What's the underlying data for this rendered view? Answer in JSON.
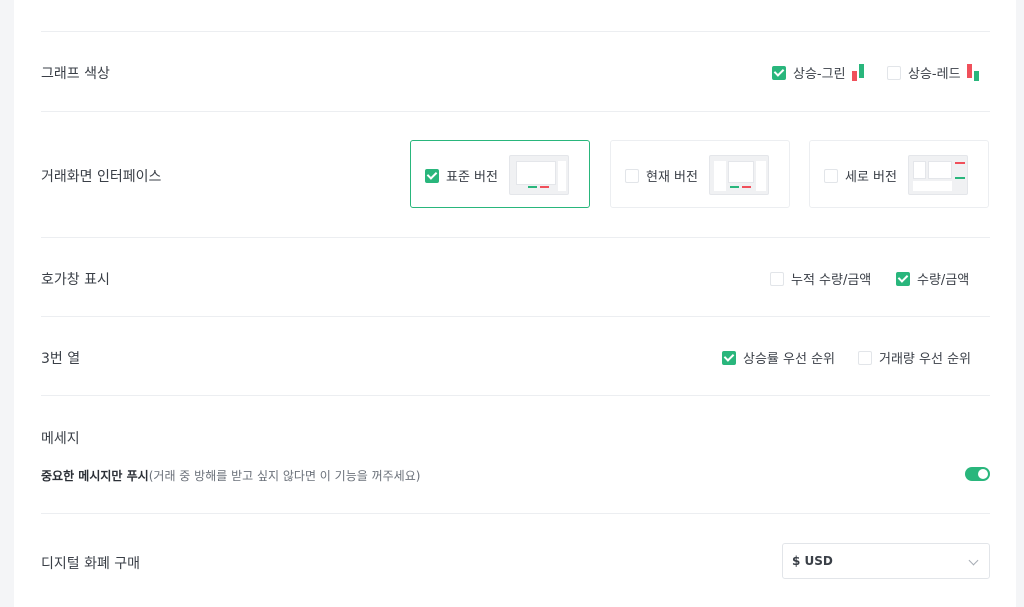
{
  "graph_color": {
    "label": "그래프 색상",
    "options": [
      {
        "label": "상승-그린",
        "checked": true
      },
      {
        "label": "상승-레드",
        "checked": false
      }
    ]
  },
  "trade_interface": {
    "label": "거래화면 인터페이스",
    "options": [
      {
        "label": "표준 버전",
        "checked": true
      },
      {
        "label": "현재 버전",
        "checked": false
      },
      {
        "label": "세로 버전",
        "checked": false
      }
    ]
  },
  "orderbook": {
    "label": "호가창 표시",
    "options": [
      {
        "label": "누적 수량/금액",
        "checked": false
      },
      {
        "label": "수량/금액",
        "checked": true
      }
    ]
  },
  "third_column": {
    "label": "3번 열",
    "options": [
      {
        "label": "상승률 우선 순위",
        "checked": true
      },
      {
        "label": "거래량 우선 순위",
        "checked": false
      }
    ]
  },
  "message": {
    "label": "메세지",
    "important_title": "중요한 메시지만 푸시",
    "important_desc": "(거래 중 방해를 받고 싶지 않다면 이 기능을 꺼주세요)",
    "toggle_on": true
  },
  "digital_currency": {
    "label": "디지털 화폐 구매",
    "selected": "$ USD"
  },
  "colors": {
    "accent": "#29b67c",
    "down": "#f0505b"
  }
}
